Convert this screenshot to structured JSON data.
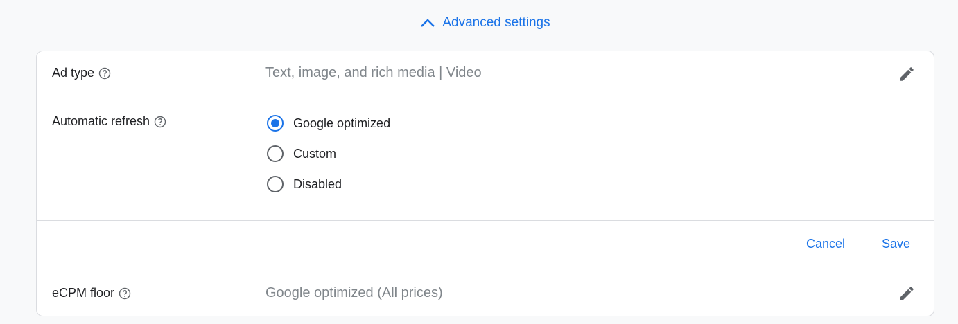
{
  "advanced_settings": {
    "label": "Advanced settings"
  },
  "ad_type": {
    "label": "Ad type",
    "value": "Text, image, and rich media | Video"
  },
  "automatic_refresh": {
    "label": "Automatic refresh",
    "options": [
      {
        "label": "Google optimized",
        "selected": true
      },
      {
        "label": "Custom",
        "selected": false
      },
      {
        "label": "Disabled",
        "selected": false
      }
    ],
    "cancel": "Cancel",
    "save": "Save"
  },
  "ecpm_floor": {
    "label": "eCPM floor",
    "value": "Google optimized (All prices)"
  },
  "colors": {
    "accent": "#1a73e8",
    "border": "#dadce0"
  }
}
